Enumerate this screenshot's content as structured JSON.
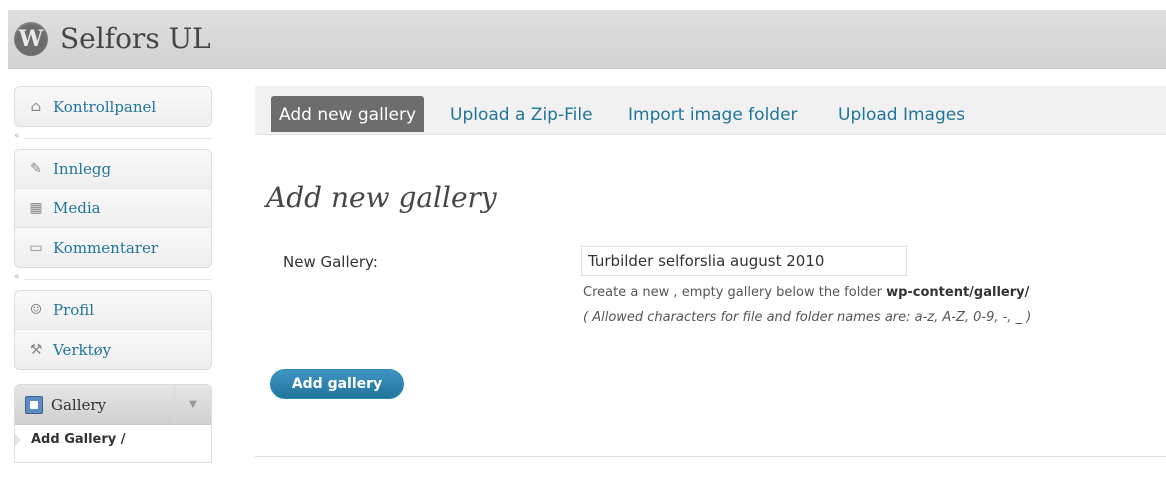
{
  "header": {
    "site_title": "Selfors UL",
    "logo_glyph": "W",
    "logo_icon": "wordpress-logo-icon"
  },
  "sidebar": {
    "dashboard": {
      "label": "Kontrollpanel",
      "icon": "home-icon"
    },
    "collapse_glyph": "«",
    "content_items": [
      {
        "label": "Innlegg",
        "icon": "pin-icon"
      },
      {
        "label": "Media",
        "icon": "media-icon"
      },
      {
        "label": "Kommentarer",
        "icon": "comment-icon"
      }
    ],
    "user_items": [
      {
        "label": "Profil",
        "icon": "users-icon"
      },
      {
        "label": "Verktøy",
        "icon": "tools-icon"
      }
    ],
    "gallery": {
      "label": "Gallery",
      "icon": "gallery-icon",
      "toggle_glyph": "▼",
      "submenu_item": "Add Gallery /"
    }
  },
  "tabs": [
    {
      "label": "Add new gallery",
      "active": true
    },
    {
      "label": "Upload a Zip-File",
      "active": false
    },
    {
      "label": "Import image folder",
      "active": false
    },
    {
      "label": "Upload Images",
      "active": false
    }
  ],
  "form": {
    "heading": "Add new gallery",
    "field_label": "New Gallery:",
    "input_value": "Turbilder selforslia august 2010",
    "hint_prefix": "Create a new , empty gallery below the folder ",
    "hint_path": "wp-content/gallery/",
    "hint_allowed": "( Allowed characters for file and folder names are: a-z, A-Z, 0-9, -, _ )",
    "submit_label": "Add gallery"
  },
  "colors": {
    "link": "#21759b",
    "active_tab": "#6d6d6d",
    "button": "#21759b"
  }
}
